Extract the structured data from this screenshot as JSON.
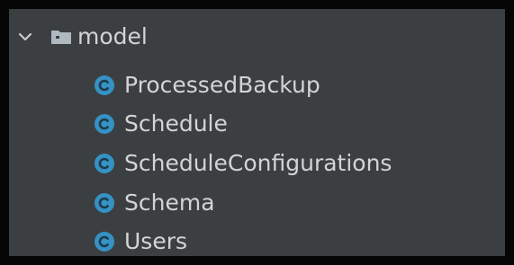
{
  "tree": {
    "folder": {
      "label": "model",
      "expanded": true,
      "icon": "folder-icon",
      "chevron_icon": "chevron-down-icon"
    },
    "items": [
      {
        "label": "ProcessedBackup",
        "icon": "class-icon"
      },
      {
        "label": "Schedule",
        "icon": "class-icon"
      },
      {
        "label": "ScheduleConfigurations",
        "icon": "class-icon"
      },
      {
        "label": "Schema",
        "icon": "class-icon"
      },
      {
        "label": "Users",
        "icon": "class-icon"
      }
    ]
  },
  "colors": {
    "background": "#3c3f41",
    "text": "#d4d4d4",
    "class_icon": "#3592c4",
    "folder_icon": "#aeb9c0",
    "border": "#050505"
  }
}
